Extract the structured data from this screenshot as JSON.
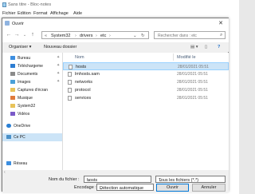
{
  "notepad": {
    "title": "Sans titre - Bloc-notes",
    "menu": [
      "Fichier",
      "Edition",
      "Format",
      "Affichage",
      "Aide"
    ]
  },
  "dialog": {
    "title": "Ouvrir",
    "close": "✕",
    "address": [
      "System32",
      "drivers",
      "etc"
    ],
    "search_placeholder": "Rechercher dans : etc",
    "organize": "Organiser ▾",
    "new_folder": "Nouveau dossier",
    "sidebar": [
      {
        "label": "Bureau",
        "color": "#3c8ee0",
        "pin": true
      },
      {
        "label": "Téléchargeme",
        "color": "#2d7dd2",
        "pin": true
      },
      {
        "label": "Documents",
        "color": "#8a8a8a",
        "pin": true
      },
      {
        "label": "Images",
        "color": "#4aa0d8",
        "pin": true
      },
      {
        "label": "Captures d'écran",
        "color": "#e8c35a",
        "pin": false
      },
      {
        "label": "Musique",
        "color": "#e07a3c",
        "pin": false
      },
      {
        "label": "System32",
        "color": "#e8c35a",
        "pin": false
      },
      {
        "label": "Vidéos",
        "color": "#7a5ac8",
        "pin": false
      },
      {
        "label": "OneDrive",
        "color": "#2a7fd4",
        "pin": false
      },
      {
        "label": "Ce PC",
        "color": "#4a90c8",
        "pin": false
      },
      {
        "label": "Réseau",
        "color": "#3c8ee0",
        "pin": false
      }
    ],
    "columns": {
      "name": "Nom",
      "modified": "Modifié le"
    },
    "files": [
      {
        "name": "hosts",
        "date": "28/01/2021 05:51"
      },
      {
        "name": "lmhosts.sam",
        "date": "28/01/2021 05:51"
      },
      {
        "name": "networks",
        "date": "28/01/2021 05:51"
      },
      {
        "name": "protocol",
        "date": "28/01/2021 05:51"
      },
      {
        "name": "services",
        "date": "28/01/2021 05:51"
      }
    ],
    "filename_label": "Nom du fichier :",
    "filename_value": "hosts",
    "filetype_value": "Tous les fichiers  (*.*)",
    "encoding_label": "Encodage :",
    "encoding_value": "Détection automatique",
    "open_button": "Ouvrir",
    "cancel_button": "Annuler"
  }
}
